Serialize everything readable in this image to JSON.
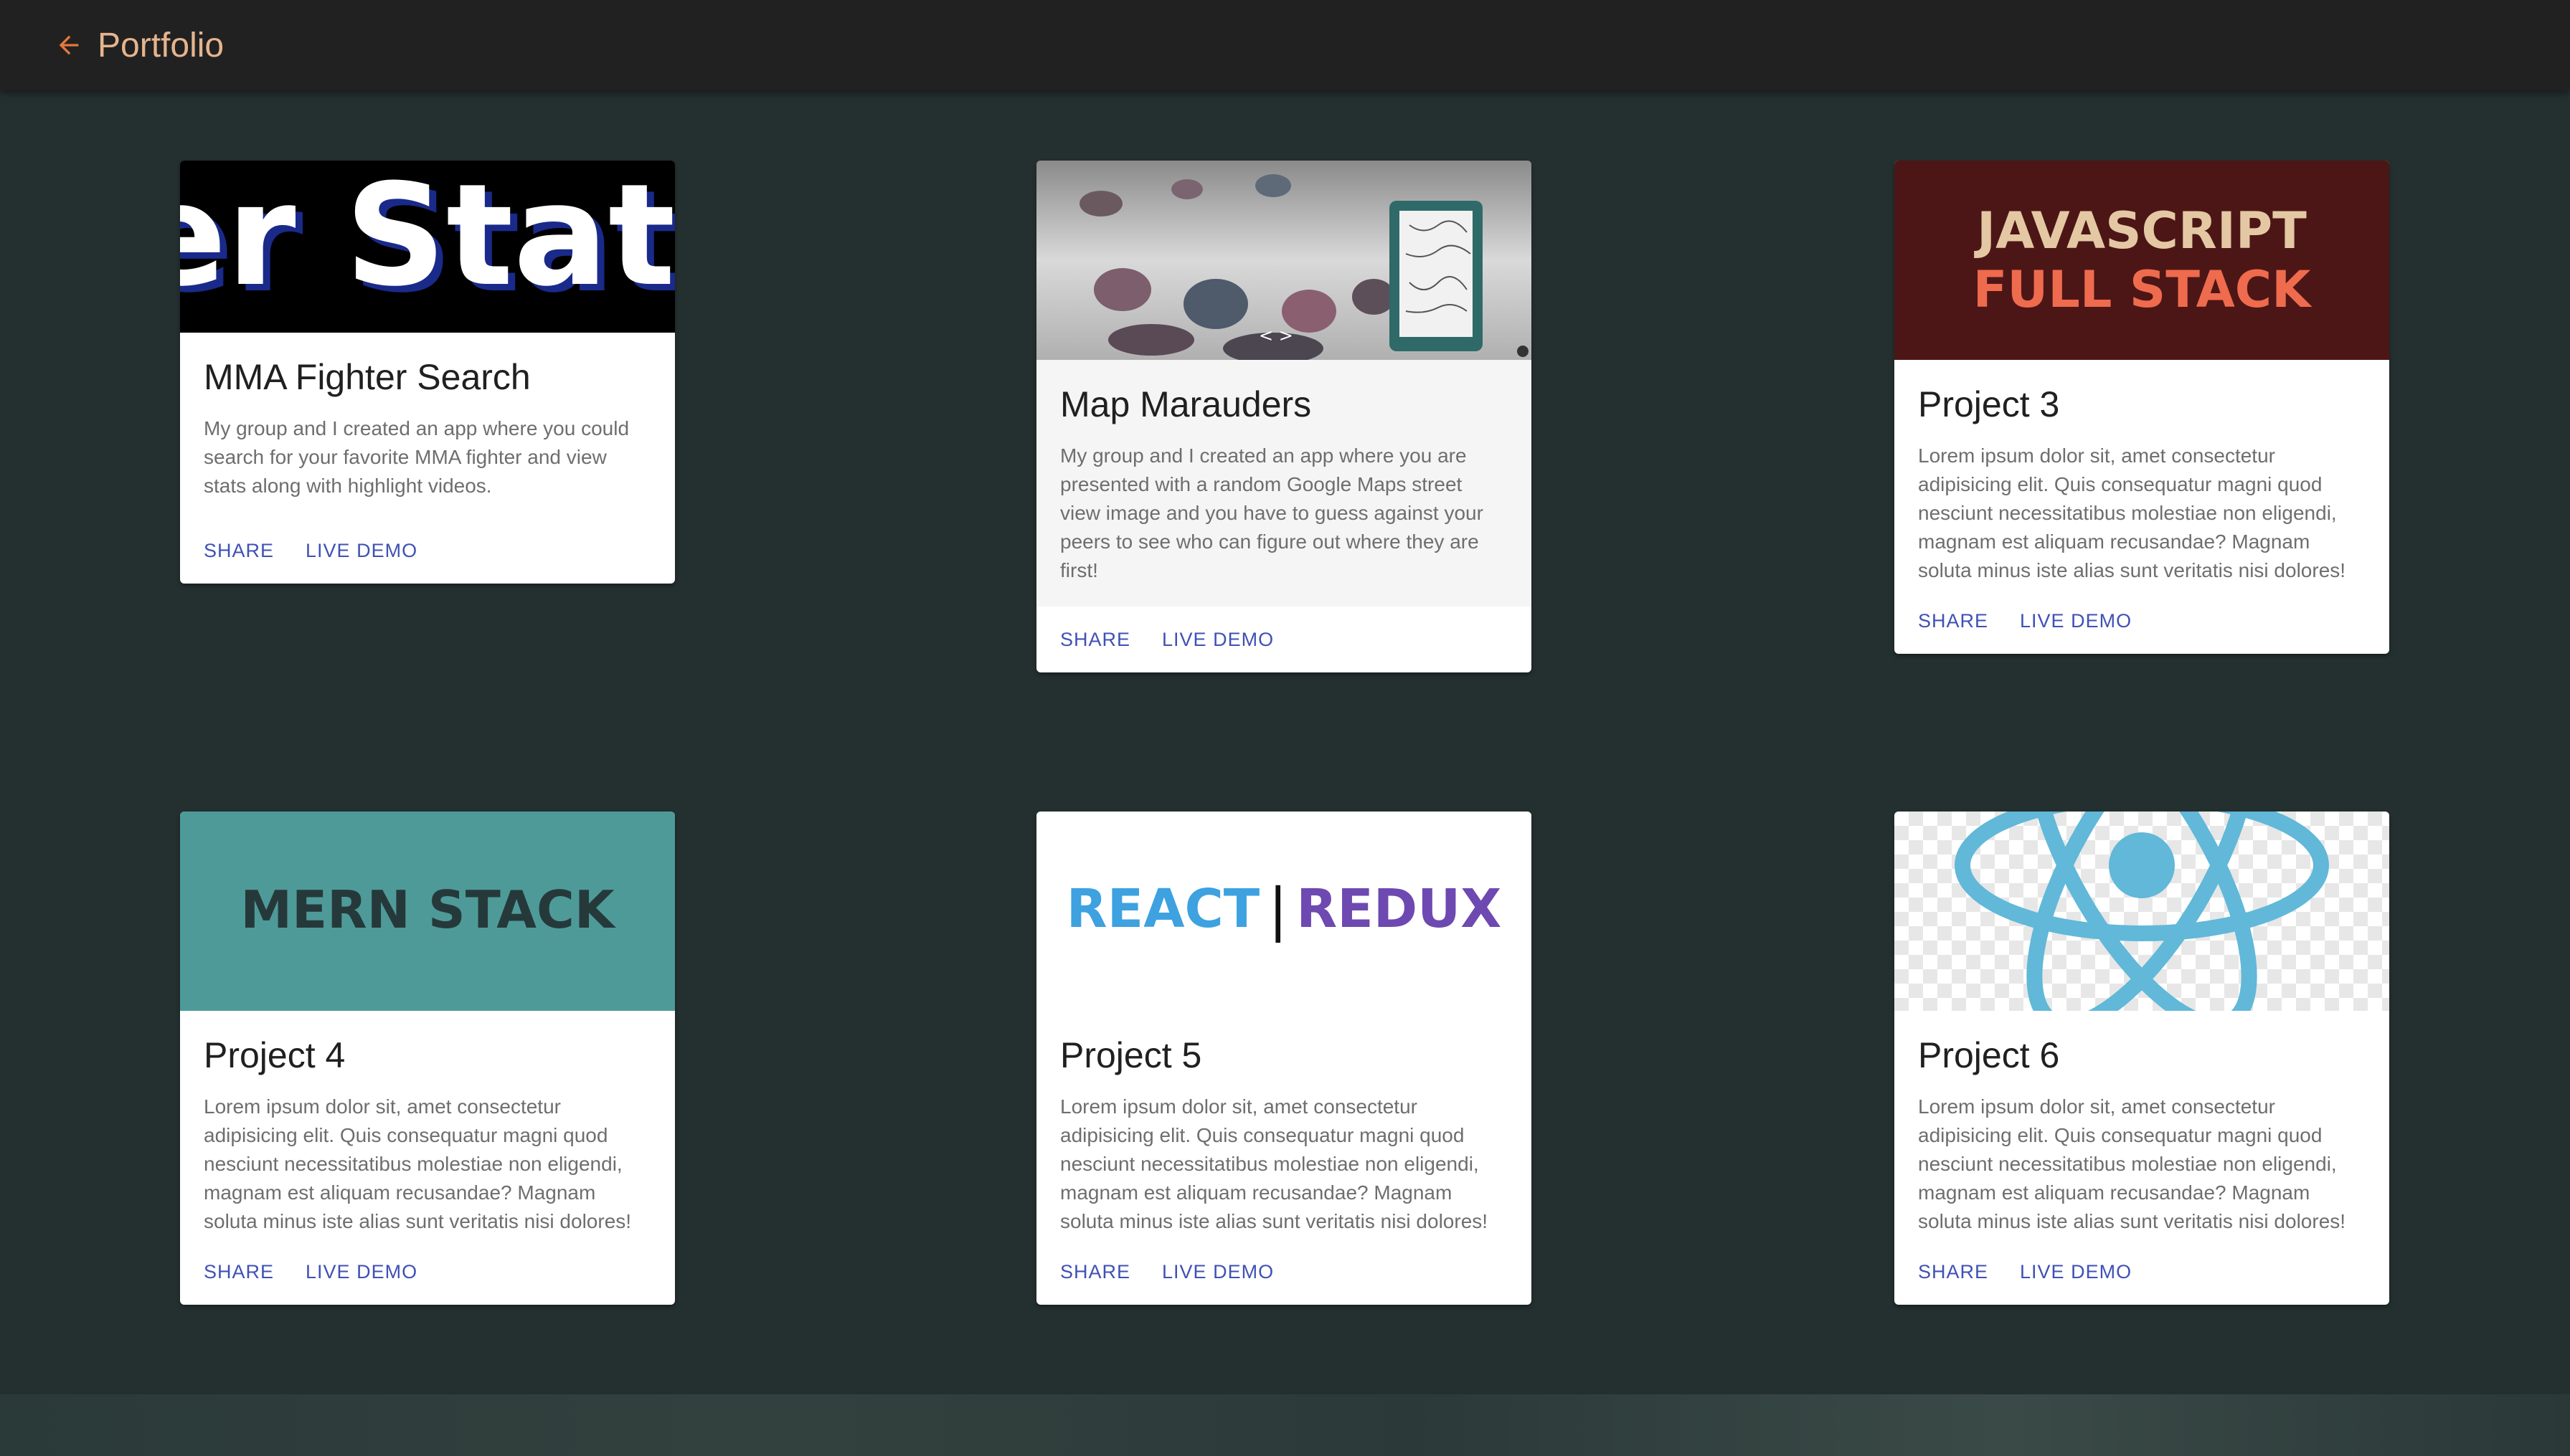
{
  "appbar": {
    "title": "Portfolio",
    "back_icon": "arrow-left-icon",
    "accent": "#e6773b"
  },
  "colors": {
    "background": "#243030",
    "action": "#3f51b5"
  },
  "cards": [
    {
      "title": "MMA Fighter Search",
      "text": "My group and I created an app where you could search for your favorite MMA fighter and view stats along with highlight videos.",
      "media_text": "er Stat",
      "share": "SHARE",
      "demo": "LIVE DEMO"
    },
    {
      "title": "Map Marauders",
      "text": "My group and I created an app where you are presented with a random Google Maps street view image and you have to guess against your peers to see who can figure out where they are first!",
      "share": "SHARE",
      "demo": "LIVE DEMO"
    },
    {
      "title": "Project 3",
      "text": "Lorem ipsum dolor sit, amet consectetur adipisicing elit. Quis consequatur magni quod nesciunt necessitatibus molestiae non eligendi, magnam est aliquam recusandae? Magnam soluta minus iste alias sunt veritatis nisi dolores!",
      "media_line1": "JAVASCRIPT",
      "media_line2": "FULL STACK",
      "share": "SHARE",
      "demo": "LIVE DEMO"
    },
    {
      "title": "Project 4",
      "text": "Lorem ipsum dolor sit, amet consectetur adipisicing elit. Quis consequatur magni quod nesciunt necessitatibus molestiae non eligendi, magnam est aliquam recusandae? Magnam soluta minus iste alias sunt veritatis nisi dolores!",
      "media_text": "MERN STACK",
      "share": "SHARE",
      "demo": "LIVE DEMO"
    },
    {
      "title": "Project 5",
      "text": "Lorem ipsum dolor sit, amet consectetur adipisicing elit. Quis consequatur magni quod nesciunt necessitatibus molestiae non eligendi, magnam est aliquam recusandae? Magnam soluta minus iste alias sunt veritatis nisi dolores!",
      "media_left": "REACT",
      "media_sep": "|",
      "media_right": "REDUX",
      "share": "SHARE",
      "demo": "LIVE DEMO"
    },
    {
      "title": "Project 6",
      "text": "Lorem ipsum dolor sit, amet consectetur adipisicing elit. Quis consequatur magni quod nesciunt necessitatibus molestiae non eligendi, magnam est aliquam recusandae? Magnam soluta minus iste alias sunt veritatis nisi dolores!",
      "media_icon": "react-atom-icon",
      "share": "SHARE",
      "demo": "LIVE DEMO"
    }
  ]
}
